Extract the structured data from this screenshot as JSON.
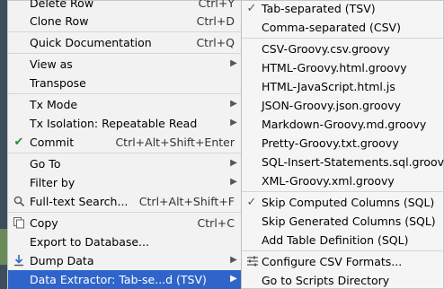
{
  "left_menu": {
    "items": [
      {
        "label": "Delete Row",
        "shortcut": "Ctrl+Y"
      },
      {
        "label": "Clone Row",
        "shortcut": "Ctrl+D"
      },
      {
        "label": "Quick Documentation",
        "shortcut": "Ctrl+Q"
      },
      {
        "label": "View as"
      },
      {
        "label": "Transpose"
      },
      {
        "label": "Tx Mode"
      },
      {
        "label": "Tx Isolation: Repeatable Read"
      },
      {
        "label": "Commit",
        "shortcut": "Ctrl+Alt+Shift+Enter"
      },
      {
        "label": "Go To"
      },
      {
        "label": "Filter by"
      },
      {
        "label": "Full-text Search...",
        "shortcut": "Ctrl+Alt+Shift+F"
      },
      {
        "label": "Copy",
        "shortcut": "Ctrl+C"
      },
      {
        "label": "Export to Database..."
      },
      {
        "label": "Dump Data"
      },
      {
        "label": "Data Extractor: Tab-se...d (TSV)"
      }
    ]
  },
  "right_menu": {
    "items": [
      {
        "label": "Tab-separated (TSV)",
        "checked": true
      },
      {
        "label": "Comma-separated (CSV)"
      },
      {
        "label": "CSV-Groovy.csv.groovy"
      },
      {
        "label": "HTML-Groovy.html.groovy"
      },
      {
        "label": "HTML-JavaScript.html.js"
      },
      {
        "label": "JSON-Groovy.json.groovy"
      },
      {
        "label": "Markdown-Groovy.md.groovy"
      },
      {
        "label": "Pretty-Groovy.txt.groovy"
      },
      {
        "label": "SQL-Insert-Statements.sql.groovy"
      },
      {
        "label": "XML-Groovy.xml.groovy"
      },
      {
        "label": "Skip Computed Columns (SQL)",
        "checked": true
      },
      {
        "label": "Skip Generated Columns (SQL)"
      },
      {
        "label": "Add Table Definition (SQL)"
      },
      {
        "label": "Configure CSV Formats..."
      },
      {
        "label": "Go to Scripts Directory"
      }
    ]
  },
  "colors": {
    "selection": "#2f65ca",
    "menu_bg": "#f2f2f2",
    "check": "#2e8b2e"
  }
}
